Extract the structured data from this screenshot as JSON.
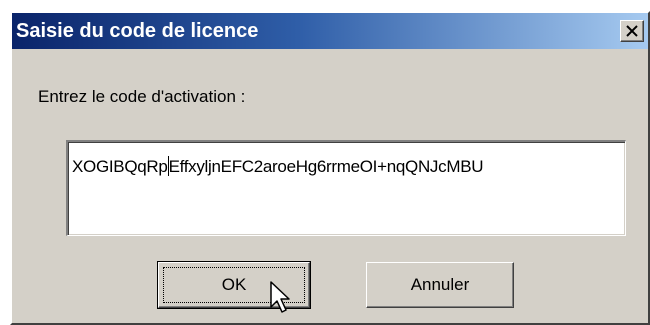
{
  "dialog": {
    "title": "Saisie du code de licence",
    "close_glyph": "X"
  },
  "form": {
    "prompt": "Entrez le code d'activation :",
    "code_before_caret": "XOGIBQqRp",
    "code_after_caret": "EffxyljnEFC2aroeHg6rrmeOI+nqQNJcMBU"
  },
  "buttons": {
    "ok_label": "OK",
    "cancel_label": "Annuler"
  },
  "icons": {
    "close": "close-icon",
    "pointer": "mouse-pointer-icon"
  },
  "colors": {
    "titlebar_start": "#0a246a",
    "titlebar_end": "#a6caf0",
    "face": "#d4d0c8"
  }
}
